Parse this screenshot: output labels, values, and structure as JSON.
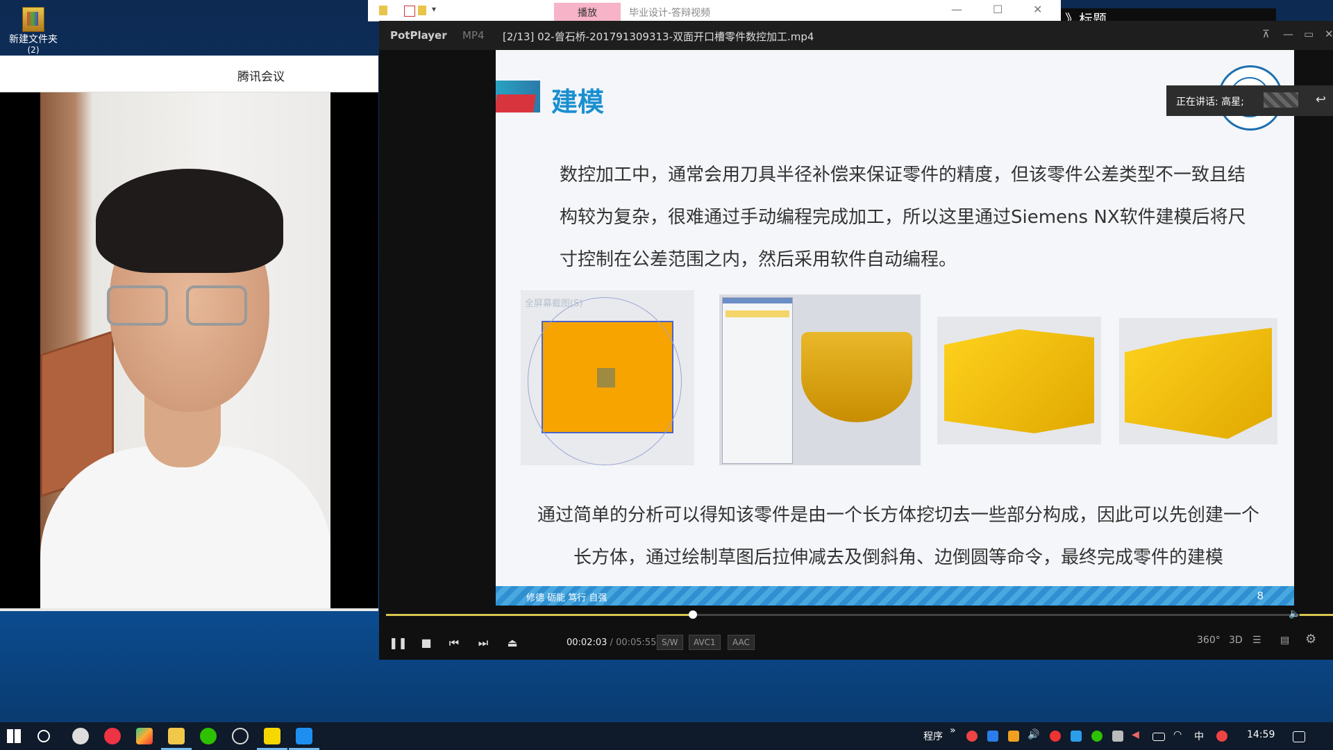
{
  "desktop": {
    "icon_label": "新建文件夹",
    "icon_label_sub": "(2)"
  },
  "meeting": {
    "title": "腾讯会议"
  },
  "explorer": {
    "tab_label": "播放",
    "path": "毕业设计-答辩视频"
  },
  "top_right": {
    "text": "》标题"
  },
  "player": {
    "app_name": "PotPlayer",
    "format": "MP4",
    "file_title": "[2/13] 02-曾石桥-201791309313-双面开口槽零件数控加工.mp4",
    "current_time": "00:02:03",
    "separator": "/",
    "duration": "00:05:55",
    "badges": [
      "S/W",
      "AVC1",
      "AAC"
    ],
    "progress_fraction": 0.33,
    "speaking_label": "正在讲话: 高星;"
  },
  "slide": {
    "heading": "建模",
    "paragraph1": "数控加工中，通常会用刀具半径补偿来保证零件的精度，但该零件公差类型不一致且结构较为复杂，很难通过手动编程完成加工，所以这里通过Siemens NX软件建模后将尺寸控制在公差范围之内，然后采用软件自动编程。",
    "paragraph2": "通过简单的分析可以得知该零件是由一个长方体挖切去一些部分构成，因此可以先创建一个长方体，通过绘制草图后拉伸减去及倒斜角、边倒圆等命令，最终完成零件的建模",
    "faint_label": "全屏幕截图(S)",
    "footer_motto": "修德 砺能 笃行 自强",
    "page_number": "8"
  },
  "taskbar": {
    "tray_label": "程序",
    "ime": "中",
    "clock": "14:59"
  },
  "colors": {
    "accent": "#1a8fd0",
    "part_yellow": "#f2b400",
    "seek": "#d8c650"
  }
}
